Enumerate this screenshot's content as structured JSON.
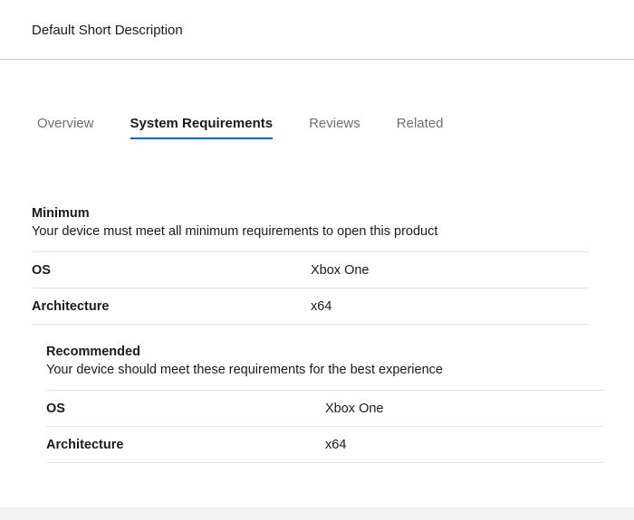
{
  "header": {
    "short_description": "Default Short Description"
  },
  "tabs": [
    {
      "label": "Overview"
    },
    {
      "label": "System Requirements"
    },
    {
      "label": "Reviews"
    },
    {
      "label": "Related"
    }
  ],
  "active_tab": "System Requirements",
  "minimum": {
    "title": "Minimum",
    "description": "Your device must meet all minimum requirements to open this product",
    "rows": [
      {
        "label": "OS",
        "value": "Xbox One"
      },
      {
        "label": "Architecture",
        "value": "x64"
      }
    ]
  },
  "recommended": {
    "title": "Recommended",
    "description": "Your device should meet these requirements for the best experience",
    "rows": [
      {
        "label": "OS",
        "value": "Xbox One"
      },
      {
        "label": "Architecture",
        "value": "x64"
      }
    ]
  },
  "colors": {
    "accent": "#0067b8",
    "divider": "#e3e3e3",
    "inactive_tab": "#6e6e6e"
  }
}
